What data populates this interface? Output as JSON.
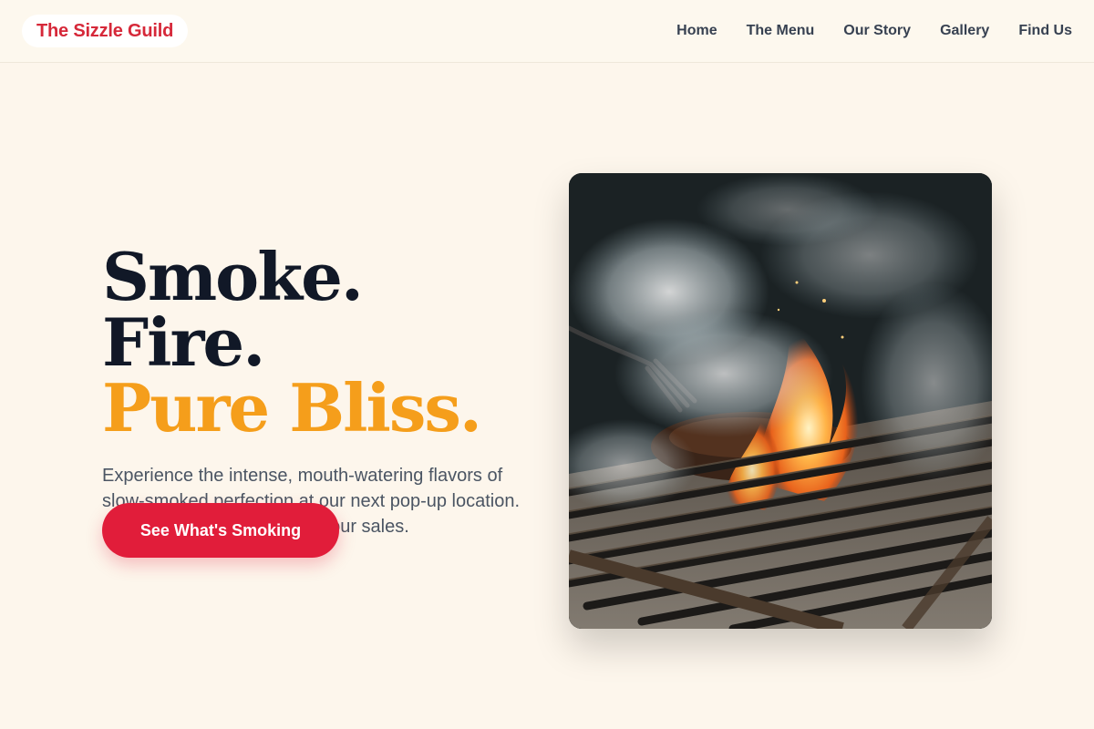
{
  "brand": {
    "name": "The Sizzle Guild",
    "color": "#d62839"
  },
  "nav": {
    "items": [
      {
        "label": "Home"
      },
      {
        "label": "The Menu"
      },
      {
        "label": "Our Story"
      },
      {
        "label": "Gallery"
      },
      {
        "label": "Find Us"
      }
    ]
  },
  "hero": {
    "headline_line1": "Smoke. Fire.",
    "headline_line2": "Pure Bliss.",
    "lede": "Experience the intense, mouth-watering flavors of slow-smoked perfection at our next pop-up location. Sizzle your skewers, scale your sales.",
    "cta_label": "See What's Smoking",
    "image_alt": "Meat grilling over a smoky flame on a metal grate",
    "colors": {
      "accent": "#f59e1b",
      "cta": "#e11d3a",
      "background": "#fdf6ec"
    }
  }
}
